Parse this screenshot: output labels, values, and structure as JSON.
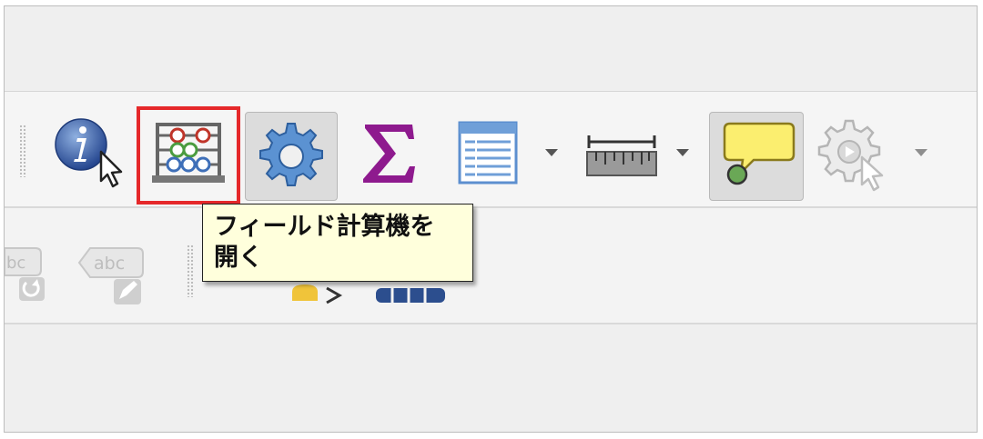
{
  "toolbar_attributes": {
    "tools": [
      {
        "icon": "identify-features-icon",
        "state": "normal"
      },
      {
        "icon": "field-calculator-icon",
        "state": "highlighted"
      },
      {
        "icon": "processing-toolbox-gear-icon",
        "state": "pressed"
      },
      {
        "icon": "statistical-summary-sigma-icon",
        "state": "normal"
      },
      {
        "icon": "attribute-table-icon",
        "state": "normal",
        "has_menu": true
      },
      {
        "icon": "measure-ruler-icon",
        "state": "normal",
        "has_menu": true
      },
      {
        "icon": "map-tips-icon",
        "state": "pressed"
      },
      {
        "icon": "run-feature-action-icon",
        "state": "disabled",
        "has_menu": true
      }
    ]
  },
  "toolbar_labels": {
    "partial_label_text": "bc",
    "label_tool_text": "abc"
  },
  "tooltip": {
    "line1": "フィールド計算機を",
    "line2": "開く"
  },
  "colors": {
    "highlight_border": "#e5282a",
    "tooltip_background": "#ffffdc",
    "sigma": "#8e1a8e",
    "gear": "#3f7fc0"
  }
}
